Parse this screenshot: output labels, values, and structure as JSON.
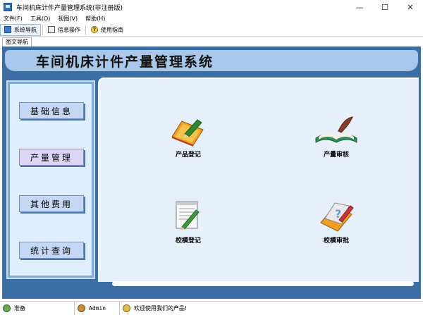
{
  "window": {
    "title": "车间机床计件产量管理系统(非注册版)",
    "controls": {
      "minimize": "—",
      "maximize": "☐",
      "close": "✕"
    }
  },
  "menu": [
    "文件(F)",
    "工具(O)",
    "视图(V)",
    "帮助(H)"
  ],
  "toolbar": {
    "nav": "系统导航",
    "info": "信息操作",
    "help": "使用指南"
  },
  "tab": {
    "label": "图文导航"
  },
  "header": {
    "title": "车间机床计件产量管理系统"
  },
  "sidebar": {
    "items": [
      "基础信息",
      "产量管理",
      "其他费用",
      "统计查询"
    ],
    "active_index": 1
  },
  "modules": {
    "register": "产品登记",
    "audit": "产量审核",
    "mold_register": "校模登记",
    "mold_approve": "校模审批"
  },
  "status": {
    "ready": "准备",
    "user": "Admin",
    "message": "欢迎使用我们的产品!"
  },
  "colors": {
    "frame_blue": "#3b6ea5",
    "header_light": "#a9c7e9",
    "content_bg": "#e6f0fb",
    "active_button": "#dcd6f7"
  }
}
